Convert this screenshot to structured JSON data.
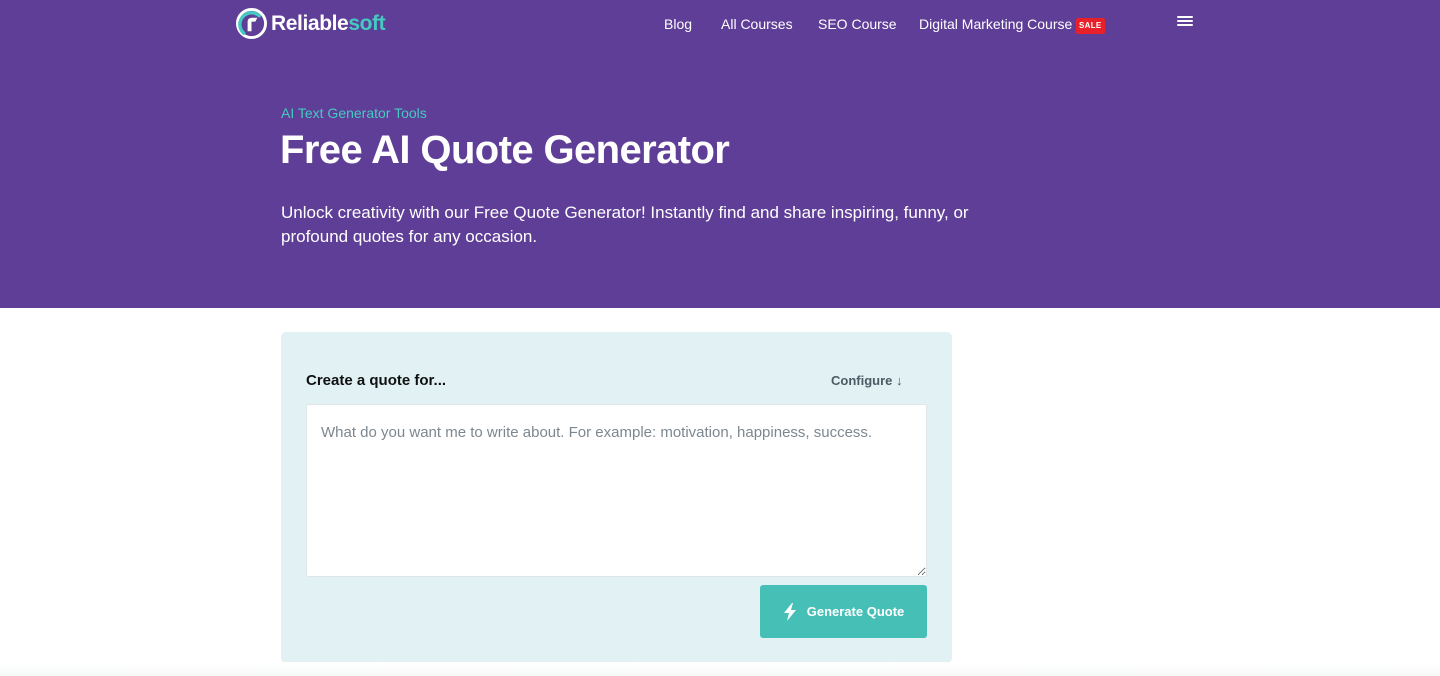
{
  "brand": {
    "name_part1": "Reliable",
    "name_part2": "soft",
    "logo_icon": "reliablesoft-logo-icon"
  },
  "nav": {
    "items": [
      {
        "label": "Blog"
      },
      {
        "label": "All Courses"
      },
      {
        "label": "SEO Course"
      },
      {
        "label": "Digital Marketing Course",
        "badge": "SALE"
      }
    ],
    "menu_icon": "hamburger-menu-icon"
  },
  "hero": {
    "breadcrumb": "AI Text Generator Tools",
    "title": "Free AI Quote Generator",
    "description": "Unlock creativity with our Free Quote Generator! Instantly find and share inspiring, funny, or profound quotes for any occasion."
  },
  "tool": {
    "label": "Create a quote for...",
    "configure_label": "Configure ↓",
    "input": {
      "value": "",
      "placeholder": "What do you want me to write about. For example: motivation, happiness, success."
    },
    "button_label": "Generate Quote",
    "button_icon": "lightning-bolt-icon"
  },
  "colors": {
    "header_bg": "#5f3e97",
    "accent_teal": "#46c9c1",
    "button_bg": "#46c0b6",
    "card_bg": "#e2f1f3",
    "sale_badge": "#e8202a"
  }
}
